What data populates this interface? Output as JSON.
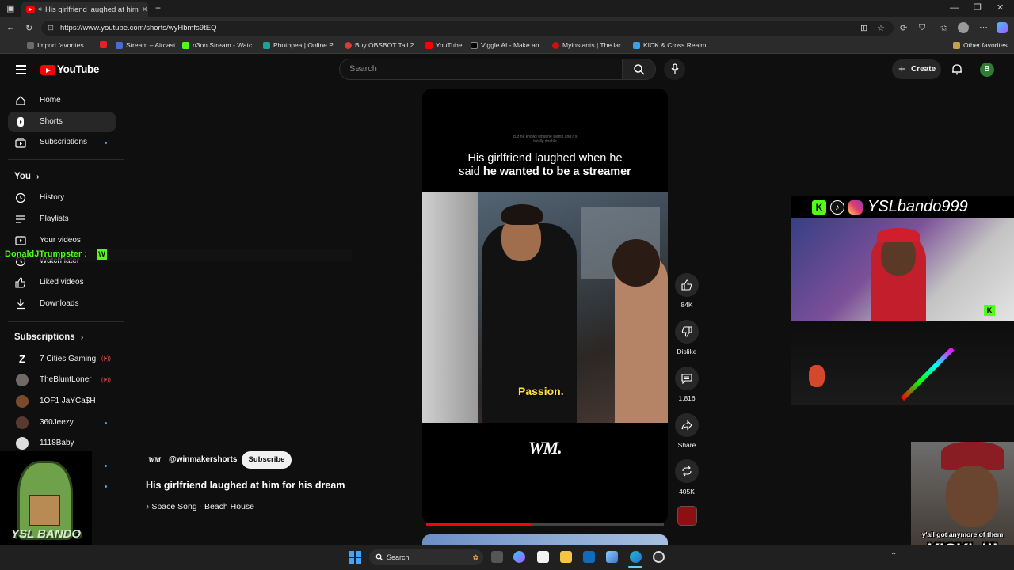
{
  "browser": {
    "tab_title": "His girlfriend laughed at him",
    "url": "https://www.youtube.com/shorts/wyHbmfs9tEQ",
    "bookmarks": [
      "Import favorites",
      "Stream – Aircast",
      "n3on Stream - Watc...",
      "Photopea | Online P...",
      "Buy OBSBOT Tail 2...",
      "YouTube",
      "Viggle AI - Make an...",
      "Myinstants | The lar...",
      "KICK & Cross Realm..."
    ],
    "other_favorites": "Other favorites"
  },
  "header": {
    "logo": "YouTube",
    "search_placeholder": "Search",
    "create": "Create",
    "avatar_letter": "B"
  },
  "sidebar": {
    "main": [
      "Home",
      "Shorts",
      "Subscriptions"
    ],
    "you_label": "You",
    "you_items": [
      "History",
      "Playlists",
      "Your videos",
      "Watch later",
      "Liked videos",
      "Downloads"
    ],
    "subscriptions_label": "Subscriptions",
    "channels": [
      "7 Cities Gaming",
      "TheBluntLoner",
      "1OF1 JaYCa$H",
      "360Jeezy",
      "1118Baby"
    ]
  },
  "chat_overlay": {
    "user": "DonaldJTrumpster :",
    "emote": "W"
  },
  "short": {
    "caption_small": "cuz he knows what he wants and it's totally doable",
    "caption_main_1": "His girlfriend laughed when he",
    "caption_main_2a": "said",
    "caption_main_2b": "he wanted to be a streamer",
    "subtitle": "Passion.",
    "watermark": "WM.",
    "progress": 0.44,
    "channel": "@winmakershorts",
    "subscribe": "Subscribe",
    "title": "His girlfriend laughed at him for his dream",
    "music": "Space Song · Beach House"
  },
  "actions": {
    "likes": "84K",
    "dislike": "Dislike",
    "comments": "1,816",
    "share": "Share",
    "remix": "405K"
  },
  "stream_overlays": {
    "social_handle": "YSLbando999",
    "bottom_caption_1": "y'all got anymore of them",
    "bottom_caption_2": "KICK's!!!",
    "stamp_text": "YSL BANDO"
  },
  "taskbar": {
    "search": "Search"
  },
  "colors": {
    "accent_red": "#ff0000",
    "kick_green": "#53fc18",
    "subtitle_yellow": "#ffe23a"
  }
}
